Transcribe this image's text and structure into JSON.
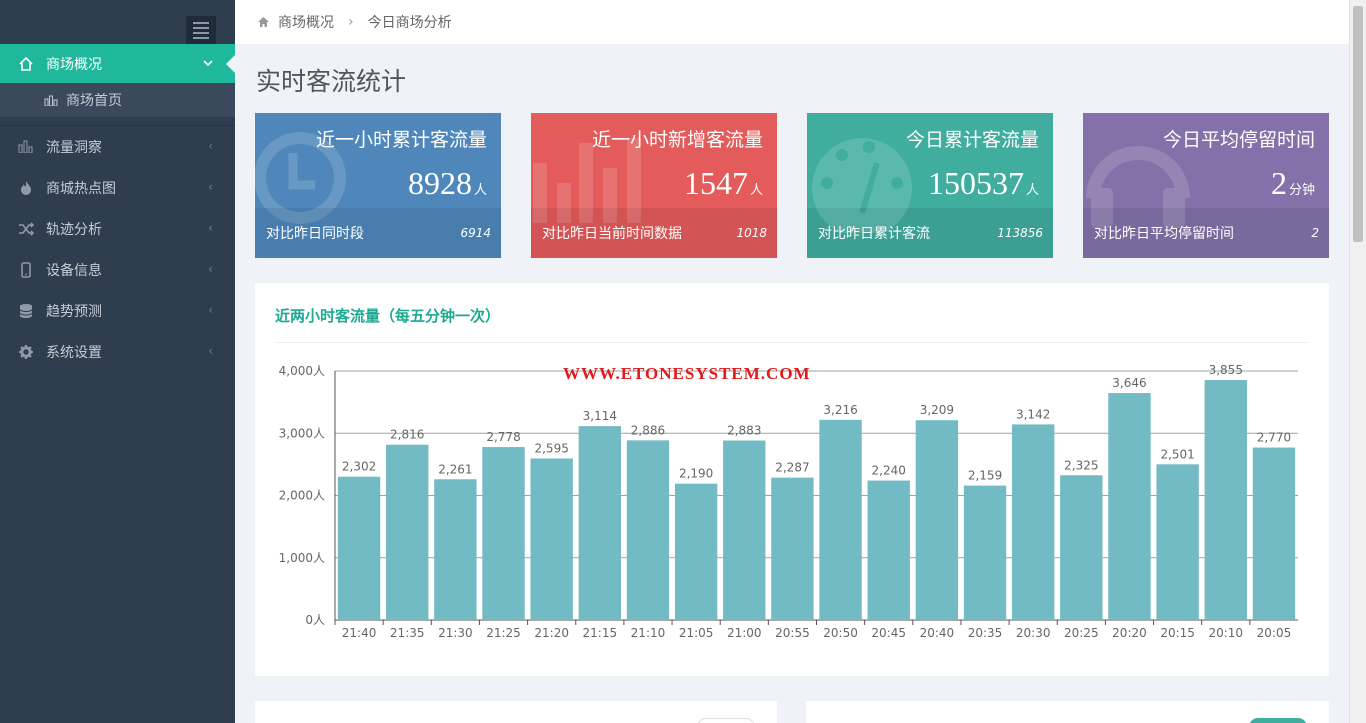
{
  "sidebar": {
    "items": [
      {
        "label": "商场概况",
        "icon": "home-icon",
        "active": true
      },
      {
        "label": "流量洞察",
        "icon": "bar-chart-icon"
      },
      {
        "label": "商城热点图",
        "icon": "fire-icon"
      },
      {
        "label": "轨迹分析",
        "icon": "shuffle-icon"
      },
      {
        "label": "设备信息",
        "icon": "mobile-icon"
      },
      {
        "label": "趋势预测",
        "icon": "database-icon"
      },
      {
        "label": "系统设置",
        "icon": "gear-icon"
      }
    ],
    "sub_item": {
      "label": "商场首页",
      "icon": "bar-chart-icon"
    }
  },
  "breadcrumb": {
    "root": "商场概况",
    "current": "今日商场分析"
  },
  "page_title": "实时客流统计",
  "cards": [
    {
      "title": "近一小时累计客流量",
      "value": "8928",
      "unit": "人",
      "compare_label": "对比昨日同时段",
      "compare_value": "6914",
      "color": "#4f87bb",
      "icon": "clock-icon"
    },
    {
      "title": "近一小时新增客流量",
      "value": "1547",
      "unit": "人",
      "compare_label": "对比昨日当前时间数据",
      "compare_value": "1018",
      "color": "#e35b5b",
      "icon": "bar-chart-icon"
    },
    {
      "title": "今日累计客流量",
      "value": "150537",
      "unit": "人",
      "compare_label": "对比昨日累计客流",
      "compare_value": "113856",
      "color": "#40ad9f",
      "icon": "dashboard-icon"
    },
    {
      "title": "今日平均停留时间",
      "value": "2",
      "unit": "分钟",
      "compare_label": "对比昨日平均停留时间",
      "compare_value": "2",
      "color": "#8471a9",
      "icon": "headphones-icon"
    }
  ],
  "watermark": "WWW.ETONESYSTEM.COM",
  "chart_data": {
    "type": "bar",
    "title": "近两小时客流量（每五分钟一次）",
    "categories": [
      "21:40",
      "21:35",
      "21:30",
      "21:25",
      "21:20",
      "21:15",
      "21:10",
      "21:05",
      "21:00",
      "20:55",
      "20:50",
      "20:45",
      "20:40",
      "20:35",
      "20:30",
      "20:25",
      "20:20",
      "20:15",
      "20:10",
      "20:05"
    ],
    "values": [
      2302,
      2816,
      2261,
      2778,
      2595,
      3114,
      2886,
      2190,
      2883,
      2287,
      3216,
      2240,
      3209,
      2159,
      3142,
      2325,
      3646,
      2501,
      3855,
      2770
    ],
    "value_labels": [
      "2,302",
      "2,816",
      "2,261",
      "2,778",
      "2,595",
      "3,114",
      "2,886",
      "2,190",
      "2,883",
      "2,287",
      "3,216",
      "2,240",
      "3,209",
      "2,159",
      "3,142",
      "2,325",
      "3,646",
      "2,501",
      "3,855",
      "2,770"
    ],
    "yticks": [
      "0人",
      "1,000人",
      "2,000人",
      "3,000人",
      "4,000人"
    ],
    "ylim": [
      0,
      4000
    ],
    "grid": true,
    "bar_color": "#72bac4"
  }
}
